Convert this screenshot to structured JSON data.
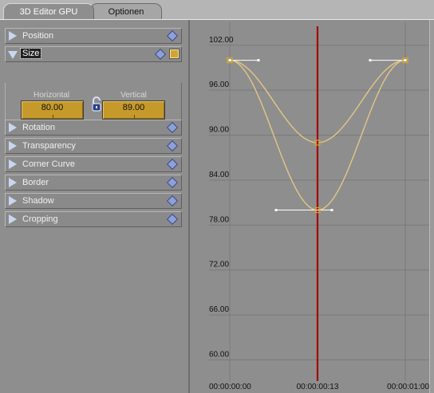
{
  "tabs": [
    {
      "label": "3D Editor GPU",
      "active": true
    },
    {
      "label": "Optionen",
      "active": false
    }
  ],
  "parameters": [
    {
      "label": "Position",
      "expanded": false,
      "selected": false,
      "keyframe": false
    },
    {
      "label": "Size",
      "expanded": true,
      "selected": true,
      "keyframe": true
    },
    {
      "label": "Rotation",
      "expanded": false,
      "selected": false,
      "keyframe": false
    },
    {
      "label": "Transparency",
      "expanded": false,
      "selected": false,
      "keyframe": false
    },
    {
      "label": "Corner Curve",
      "expanded": false,
      "selected": false,
      "keyframe": false
    },
    {
      "label": "Border",
      "expanded": false,
      "selected": false,
      "keyframe": false
    },
    {
      "label": "Shadow",
      "expanded": false,
      "selected": false,
      "keyframe": false
    },
    {
      "label": "Cropping",
      "expanded": false,
      "selected": false,
      "keyframe": false
    }
  ],
  "size": {
    "horizontal_label": "Horizontal",
    "horizontal_value": "80.00",
    "vertical_label": "Vertical",
    "vertical_value": "89.00",
    "link_icon": "chain-link-icon"
  },
  "graph": {
    "y_ticks": [
      "102.00",
      "96.00",
      "90.00",
      "84.00",
      "78.00",
      "72.00",
      "66.00",
      "60.00"
    ],
    "x_ticks": [
      "00:00:00:00",
      "00:00:00:13",
      "00:00:01:00"
    ],
    "playhead_time": "00:00:00:13",
    "colors": {
      "background": "#8e8e8e",
      "grid": "#7a7a7a",
      "curve": "#e2c784",
      "playhead": "#a60000",
      "handle": "#ffffff",
      "keyframe": "#d2a531"
    }
  },
  "chart_data": {
    "type": "line",
    "x_unit": "frames",
    "xlim": [
      0,
      25
    ],
    "ylim": [
      57.5,
      104
    ],
    "series": [
      {
        "points": [
          [
            0,
            100.0
          ],
          [
            12.5,
            80.0
          ],
          [
            25,
            100.0
          ]
        ],
        "keyframes": [
          [
            0,
            100.0
          ],
          [
            12.5,
            80.0
          ],
          [
            25,
            100.0
          ]
        ]
      },
      {
        "points": [
          [
            0,
            100.0
          ],
          [
            12.5,
            89.0
          ],
          [
            25,
            100.0
          ]
        ],
        "keyframes": [
          [
            0,
            100.0
          ],
          [
            12.5,
            89.0
          ],
          [
            25,
            100.0
          ]
        ]
      }
    ]
  }
}
